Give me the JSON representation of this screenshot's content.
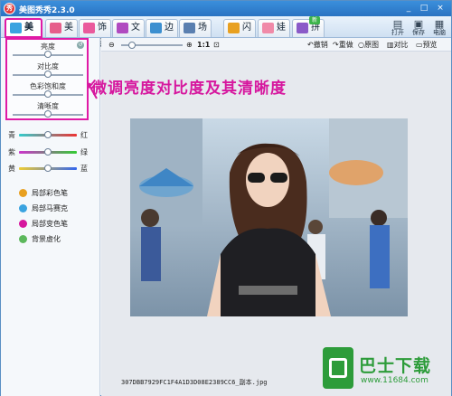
{
  "app": {
    "title": "美图秀秀2.3.0",
    "logo_char": "秀"
  },
  "window_controls": [
    "_",
    "□",
    "×"
  ],
  "tabs": [
    {
      "label": "美化",
      "color": "#3aa3e0",
      "active": true
    },
    {
      "label": "美容",
      "color": "#e65e8a",
      "active": false
    },
    {
      "label": "饰品",
      "color": "#ea5a9c",
      "active": false
    },
    {
      "label": "文字",
      "color": "#b04ac0",
      "active": false
    },
    {
      "label": "边框",
      "color": "#3c8fd0",
      "active": false
    },
    {
      "label": "场景",
      "color": "#5a7fb0",
      "active": false
    },
    {
      "label": "闪图",
      "color": "#e8a020",
      "active": false
    },
    {
      "label": "娃娃",
      "color": "#f08aa8",
      "active": false
    },
    {
      "label": "拼图",
      "color": "#8a5ac8",
      "active": false
    }
  ],
  "new_badge": "新",
  "right_tools": [
    {
      "label": "打开",
      "glyph": "▤"
    },
    {
      "label": "保存",
      "glyph": "▣"
    },
    {
      "label": "电脑",
      "glyph": "▦"
    }
  ],
  "adjust": {
    "items": [
      {
        "label": "亮度",
        "value": 0.5
      },
      {
        "label": "对比度",
        "value": 0.5
      },
      {
        "label": "色彩饱和度",
        "value": 0.5
      },
      {
        "label": "清晰度",
        "value": 0.5
      }
    ]
  },
  "color_balance": [
    {
      "left": "青",
      "right": "红",
      "value": 0.5
    },
    {
      "left": "紫",
      "right": "绿",
      "value": 0.5
    },
    {
      "left": "黄",
      "right": "蓝",
      "value": 0.5
    }
  ],
  "effects": [
    {
      "label": "局部彩色笔",
      "color": "#e8a020"
    },
    {
      "label": "局部马赛克",
      "color": "#3aa3e0"
    },
    {
      "label": "局部变色笔",
      "color": "#d6179e"
    },
    {
      "label": "背景虚化",
      "color": "#5cb85c"
    }
  ],
  "canvas_controls": {
    "zoom_ratio": "1:1",
    "undo": "撤销",
    "redo": "重做",
    "original": "原图",
    "compare": "对比",
    "preview": "预览"
  },
  "annotation": "微调亮度对比度及其清晰度",
  "status": {
    "filename": "307DBB7929FC1F4A1D3D08E2389CC6_副本.jpg"
  },
  "watermark": {
    "name": "巴士下载",
    "url": "www.11684.com"
  }
}
